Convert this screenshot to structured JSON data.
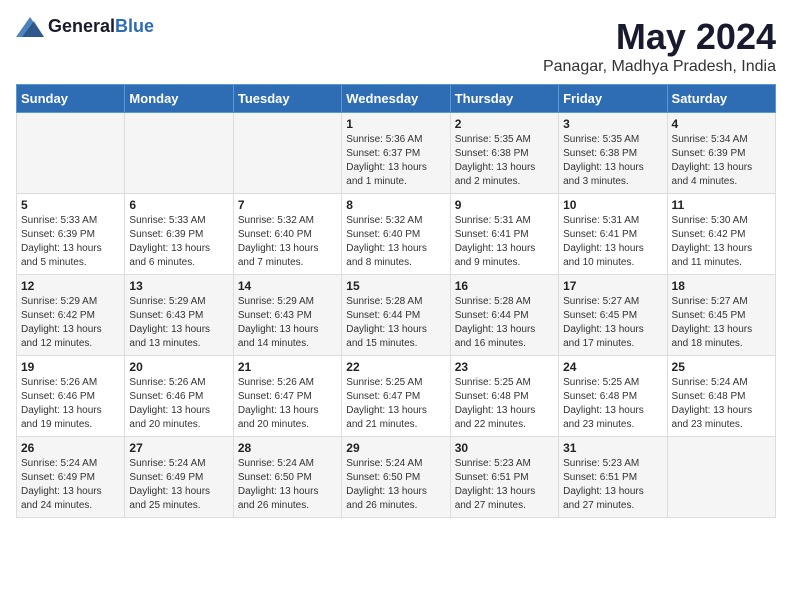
{
  "header": {
    "logo_general": "General",
    "logo_blue": "Blue",
    "title": "May 2024",
    "subtitle": "Panagar, Madhya Pradesh, India"
  },
  "days_of_week": [
    "Sunday",
    "Monday",
    "Tuesday",
    "Wednesday",
    "Thursday",
    "Friday",
    "Saturday"
  ],
  "weeks": [
    [
      {
        "day": "",
        "info": ""
      },
      {
        "day": "",
        "info": ""
      },
      {
        "day": "",
        "info": ""
      },
      {
        "day": "1",
        "info": "Sunrise: 5:36 AM\nSunset: 6:37 PM\nDaylight: 13 hours\nand 1 minute."
      },
      {
        "day": "2",
        "info": "Sunrise: 5:35 AM\nSunset: 6:38 PM\nDaylight: 13 hours\nand 2 minutes."
      },
      {
        "day": "3",
        "info": "Sunrise: 5:35 AM\nSunset: 6:38 PM\nDaylight: 13 hours\nand 3 minutes."
      },
      {
        "day": "4",
        "info": "Sunrise: 5:34 AM\nSunset: 6:39 PM\nDaylight: 13 hours\nand 4 minutes."
      }
    ],
    [
      {
        "day": "5",
        "info": "Sunrise: 5:33 AM\nSunset: 6:39 PM\nDaylight: 13 hours\nand 5 minutes."
      },
      {
        "day": "6",
        "info": "Sunrise: 5:33 AM\nSunset: 6:39 PM\nDaylight: 13 hours\nand 6 minutes."
      },
      {
        "day": "7",
        "info": "Sunrise: 5:32 AM\nSunset: 6:40 PM\nDaylight: 13 hours\nand 7 minutes."
      },
      {
        "day": "8",
        "info": "Sunrise: 5:32 AM\nSunset: 6:40 PM\nDaylight: 13 hours\nand 8 minutes."
      },
      {
        "day": "9",
        "info": "Sunrise: 5:31 AM\nSunset: 6:41 PM\nDaylight: 13 hours\nand 9 minutes."
      },
      {
        "day": "10",
        "info": "Sunrise: 5:31 AM\nSunset: 6:41 PM\nDaylight: 13 hours\nand 10 minutes."
      },
      {
        "day": "11",
        "info": "Sunrise: 5:30 AM\nSunset: 6:42 PM\nDaylight: 13 hours\nand 11 minutes."
      }
    ],
    [
      {
        "day": "12",
        "info": "Sunrise: 5:29 AM\nSunset: 6:42 PM\nDaylight: 13 hours\nand 12 minutes."
      },
      {
        "day": "13",
        "info": "Sunrise: 5:29 AM\nSunset: 6:43 PM\nDaylight: 13 hours\nand 13 minutes."
      },
      {
        "day": "14",
        "info": "Sunrise: 5:29 AM\nSunset: 6:43 PM\nDaylight: 13 hours\nand 14 minutes."
      },
      {
        "day": "15",
        "info": "Sunrise: 5:28 AM\nSunset: 6:44 PM\nDaylight: 13 hours\nand 15 minutes."
      },
      {
        "day": "16",
        "info": "Sunrise: 5:28 AM\nSunset: 6:44 PM\nDaylight: 13 hours\nand 16 minutes."
      },
      {
        "day": "17",
        "info": "Sunrise: 5:27 AM\nSunset: 6:45 PM\nDaylight: 13 hours\nand 17 minutes."
      },
      {
        "day": "18",
        "info": "Sunrise: 5:27 AM\nSunset: 6:45 PM\nDaylight: 13 hours\nand 18 minutes."
      }
    ],
    [
      {
        "day": "19",
        "info": "Sunrise: 5:26 AM\nSunset: 6:46 PM\nDaylight: 13 hours\nand 19 minutes."
      },
      {
        "day": "20",
        "info": "Sunrise: 5:26 AM\nSunset: 6:46 PM\nDaylight: 13 hours\nand 20 minutes."
      },
      {
        "day": "21",
        "info": "Sunrise: 5:26 AM\nSunset: 6:47 PM\nDaylight: 13 hours\nand 20 minutes."
      },
      {
        "day": "22",
        "info": "Sunrise: 5:25 AM\nSunset: 6:47 PM\nDaylight: 13 hours\nand 21 minutes."
      },
      {
        "day": "23",
        "info": "Sunrise: 5:25 AM\nSunset: 6:48 PM\nDaylight: 13 hours\nand 22 minutes."
      },
      {
        "day": "24",
        "info": "Sunrise: 5:25 AM\nSunset: 6:48 PM\nDaylight: 13 hours\nand 23 minutes."
      },
      {
        "day": "25",
        "info": "Sunrise: 5:24 AM\nSunset: 6:48 PM\nDaylight: 13 hours\nand 23 minutes."
      }
    ],
    [
      {
        "day": "26",
        "info": "Sunrise: 5:24 AM\nSunset: 6:49 PM\nDaylight: 13 hours\nand 24 minutes."
      },
      {
        "day": "27",
        "info": "Sunrise: 5:24 AM\nSunset: 6:49 PM\nDaylight: 13 hours\nand 25 minutes."
      },
      {
        "day": "28",
        "info": "Sunrise: 5:24 AM\nSunset: 6:50 PM\nDaylight: 13 hours\nand 26 minutes."
      },
      {
        "day": "29",
        "info": "Sunrise: 5:24 AM\nSunset: 6:50 PM\nDaylight: 13 hours\nand 26 minutes."
      },
      {
        "day": "30",
        "info": "Sunrise: 5:23 AM\nSunset: 6:51 PM\nDaylight: 13 hours\nand 27 minutes."
      },
      {
        "day": "31",
        "info": "Sunrise: 5:23 AM\nSunset: 6:51 PM\nDaylight: 13 hours\nand 27 minutes."
      },
      {
        "day": "",
        "info": ""
      }
    ]
  ]
}
